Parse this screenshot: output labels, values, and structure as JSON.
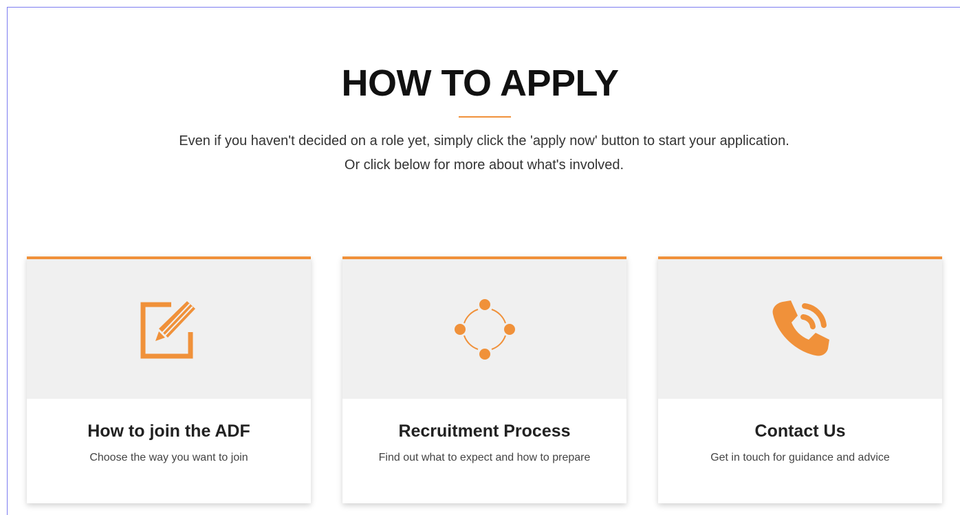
{
  "section": {
    "title": "HOW TO APPLY",
    "intro": "Even if you haven't decided on a role yet, simply click the 'apply now' button to start your application. Or click below for more about what's involved."
  },
  "colors": {
    "accent": "#f0913a",
    "card_top_bg": "#f0f0f0",
    "title": "#111111",
    "text": "#333333"
  },
  "cards": [
    {
      "icon": "edit-icon",
      "title": "How to join the ADF",
      "description": "Choose the way you want to join"
    },
    {
      "icon": "process-cycle-icon",
      "title": "Recruitment Process",
      "description": "Find out what to expect and how to prepare"
    },
    {
      "icon": "phone-icon",
      "title": "Contact Us",
      "description": "Get in touch for guidance and advice"
    }
  ]
}
